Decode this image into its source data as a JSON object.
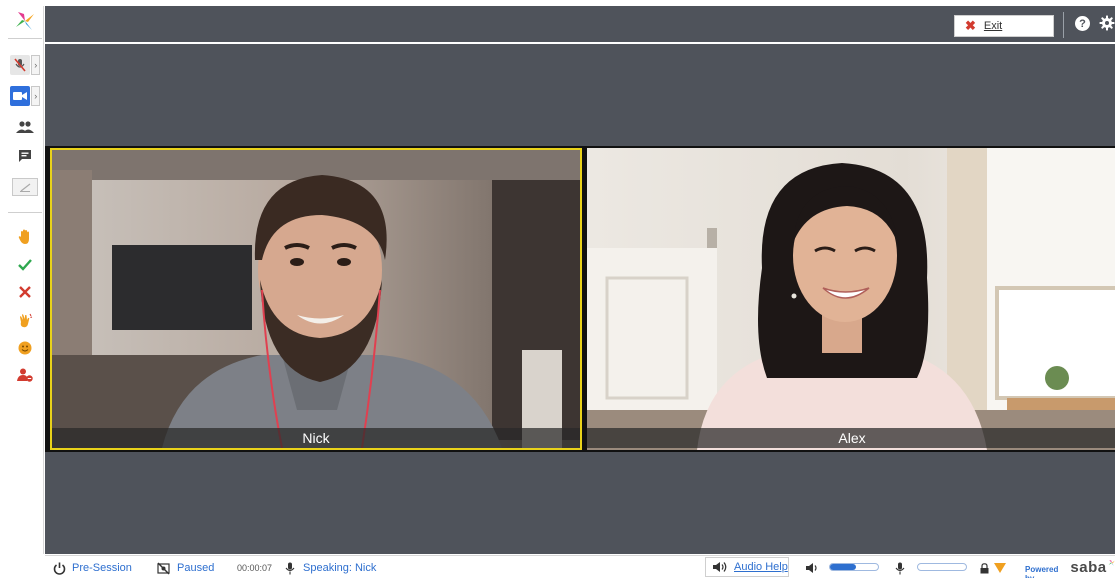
{
  "topbar": {
    "exit_label": "Exit"
  },
  "video": {
    "participants": [
      {
        "name": "Nick"
      },
      {
        "name": "Alex"
      }
    ]
  },
  "status": {
    "session": "Pre-Session",
    "recording": "Paused",
    "timer": "00:00:07",
    "speaking": "Speaking: Nick",
    "audio_help": "Audio Help",
    "speaker_level": 0.55,
    "mic_level": 0.0,
    "powered_by": "Powered by",
    "brand": "saba"
  },
  "colors": {
    "toolbar_bg": "#4f535b",
    "accent": "#2e6fcf",
    "active_speaker": "#e9d21a",
    "danger": "#d23b2f",
    "success": "#2fa84f",
    "hand": "#f0a020"
  },
  "sidebar": {
    "icons": [
      "mic-muted-icon",
      "video-camera-icon",
      "participants-icon",
      "chat-icon",
      "annotate-icon",
      "raise-hand-icon",
      "agree-icon",
      "disagree-icon",
      "applause-icon",
      "emoji-icon",
      "step-away-icon"
    ]
  }
}
